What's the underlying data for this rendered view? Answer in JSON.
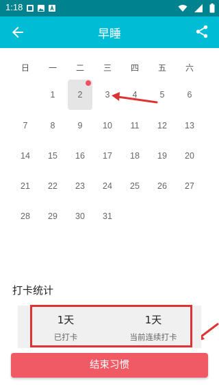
{
  "status_bar": {
    "time": "1:18",
    "left_icons": [
      "notification-icon",
      "image-icon",
      "text-a-icon"
    ],
    "right_icons": [
      "wifi-icon",
      "signal-icon",
      "battery-icon"
    ]
  },
  "app_bar": {
    "title": "早睡",
    "back_icon": "arrow-left-icon",
    "share_icon": "share-icon",
    "color": "#00bcd4"
  },
  "calendar": {
    "weekdays": [
      "日",
      "一",
      "二",
      "三",
      "四",
      "五",
      "六"
    ],
    "days": [
      "1",
      "2",
      "3",
      "4",
      "5",
      "6",
      "7",
      "8",
      "9",
      "10",
      "11",
      "12",
      "13",
      "14",
      "15",
      "16",
      "17",
      "18",
      "19",
      "20",
      "21",
      "22",
      "23",
      "24",
      "25",
      "26",
      "27",
      "28",
      "29",
      "30",
      "31"
    ],
    "selected_day": "2",
    "marked_day": "2"
  },
  "stats": {
    "title": "打卡统计",
    "checked_in_value": "1天",
    "checked_in_label": "已打卡",
    "streak_value": "1天",
    "streak_label": "当前连续打卡"
  },
  "end_button": {
    "label": "结束习惯",
    "color": "#f05a65"
  },
  "annotation_color": "#dd3333"
}
